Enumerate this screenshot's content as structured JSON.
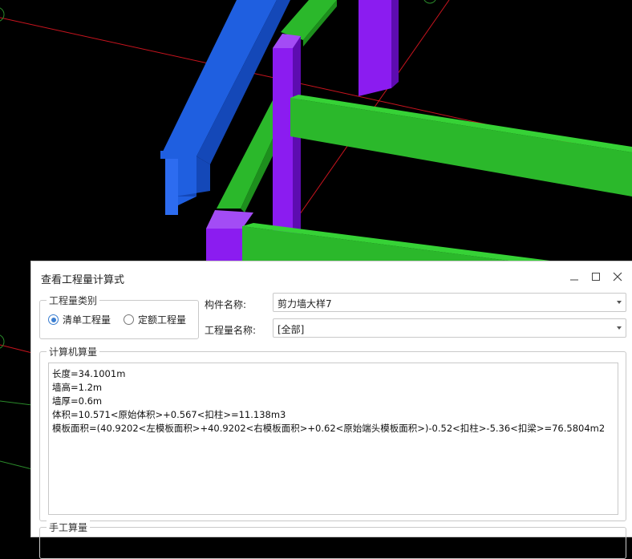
{
  "dialog": {
    "title": "查看工程量计算式",
    "category_group": {
      "legend": "工程量类别",
      "options": [
        {
          "label": "清单工程量",
          "selected": true
        },
        {
          "label": "定额工程量",
          "selected": false
        }
      ]
    },
    "component_name": {
      "label": "构件名称:",
      "value": "剪力墙大样7"
    },
    "quantity_name": {
      "label": "工程量名称:",
      "value": "[全部]"
    },
    "computer_calc": {
      "legend": "计算机算量",
      "lines": [
        "长度=34.1001m",
        "墙高=1.2m",
        "墙厚=0.6m",
        "体积=10.571<原始体积>+0.567<扣柱>=11.138m3",
        "模板面积=(40.9202<左模板面积>+40.9202<右模板面积>+0.62<原始端头模板面积>)-0.52<扣柱>-5.36<扣梁>=76.5804m2"
      ]
    },
    "manual_calc_legend": "手工算量"
  },
  "colors": {
    "blue_beam": "#1f5fe0",
    "green_beam": "#2bb82b",
    "purple_column": "#7a10e8",
    "accent": "#3c7fd1"
  },
  "icons": [
    "minimize-icon",
    "maximize-icon",
    "close-icon",
    "chevron-down-icon"
  ]
}
